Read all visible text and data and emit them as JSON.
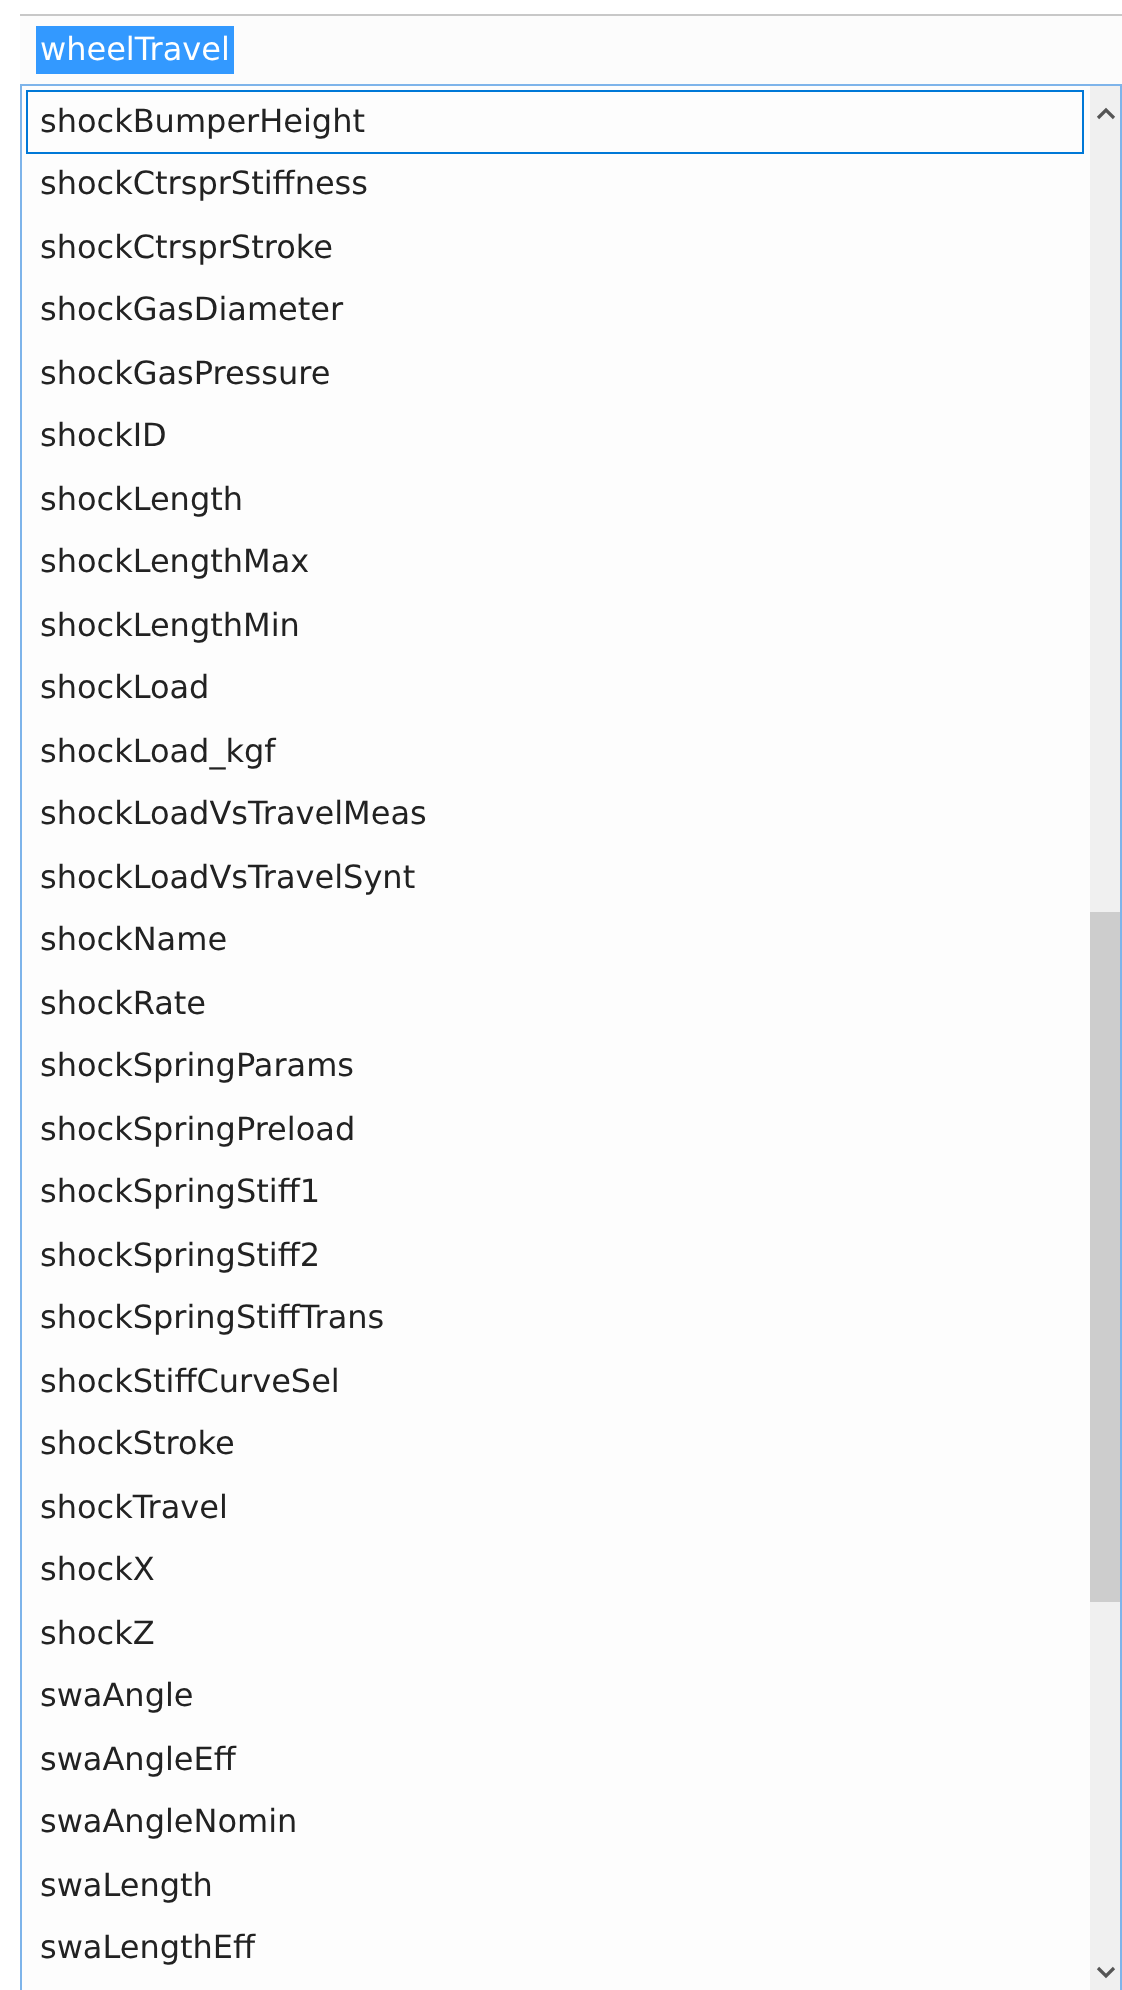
{
  "field": {
    "value": "wheelTravel",
    "text_selected": true
  },
  "list": {
    "items": [
      {
        "label": "shockBumperHeight",
        "selected": true
      },
      {
        "label": "shockCtrsprStiffness",
        "selected": false
      },
      {
        "label": "shockCtrsprStroke",
        "selected": false
      },
      {
        "label": "shockGasDiameter",
        "selected": false
      },
      {
        "label": "shockGasPressure",
        "selected": false
      },
      {
        "label": "shockID",
        "selected": false
      },
      {
        "label": "shockLength",
        "selected": false
      },
      {
        "label": "shockLengthMax",
        "selected": false
      },
      {
        "label": "shockLengthMin",
        "selected": false
      },
      {
        "label": "shockLoad",
        "selected": false
      },
      {
        "label": "shockLoad_kgf",
        "selected": false
      },
      {
        "label": "shockLoadVsTravelMeas",
        "selected": false
      },
      {
        "label": "shockLoadVsTravelSynt",
        "selected": false
      },
      {
        "label": "shockName",
        "selected": false
      },
      {
        "label": "shockRate",
        "selected": false
      },
      {
        "label": "shockSpringParams",
        "selected": false
      },
      {
        "label": "shockSpringPreload",
        "selected": false
      },
      {
        "label": "shockSpringStiff1",
        "selected": false
      },
      {
        "label": "shockSpringStiff2",
        "selected": false
      },
      {
        "label": "shockSpringStiffTrans",
        "selected": false
      },
      {
        "label": "shockStiffCurveSel",
        "selected": false
      },
      {
        "label": "shockStroke",
        "selected": false
      },
      {
        "label": "shockTravel",
        "selected": false
      },
      {
        "label": "shockX",
        "selected": false
      },
      {
        "label": "shockZ",
        "selected": false
      },
      {
        "label": "swaAngle",
        "selected": false
      },
      {
        "label": "swaAngleEff",
        "selected": false
      },
      {
        "label": "swaAngleNomin",
        "selected": false
      },
      {
        "label": "swaLength",
        "selected": false
      },
      {
        "label": "swaLengthEff",
        "selected": false
      }
    ]
  }
}
